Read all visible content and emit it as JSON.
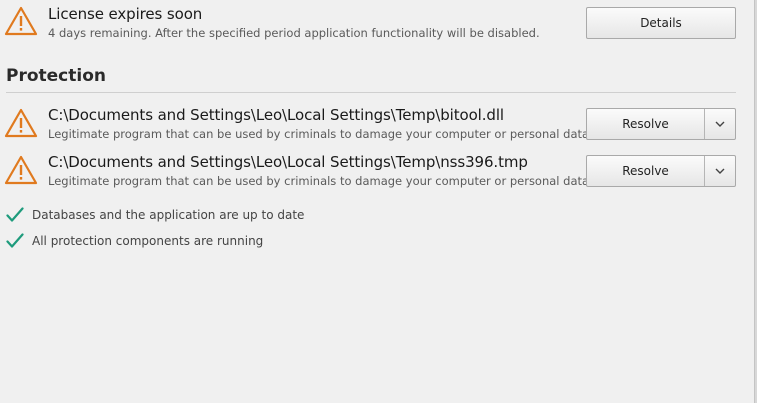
{
  "license": {
    "title": "License expires soon",
    "description": "4 days remaining. After the specified period application functionality will be disabled.",
    "details_label": "Details"
  },
  "protection": {
    "section_title": "Protection",
    "threats": [
      {
        "path": "C:\\Documents and Settings\\Leo\\Local Settings\\Temp\\bitool.dll",
        "description": "Legitimate program that can be used by criminals to damage your computer or personal data.",
        "action_label": "Resolve"
      },
      {
        "path": "C:\\Documents and Settings\\Leo\\Local Settings\\Temp\\nss396.tmp",
        "description": "Legitimate program that can be used by criminals to damage your computer or personal data.",
        "action_label": "Resolve"
      }
    ],
    "status_items": [
      {
        "text": "Databases and the application are up to date"
      },
      {
        "text": "All protection components are running"
      }
    ]
  },
  "icons": {
    "warning": "warning-triangle-icon",
    "check": "checkmark-icon",
    "dropdown": "chevron-down-icon"
  },
  "colors": {
    "warning": "#e07a1f",
    "check": "#1e9b7c",
    "background": "#f0f0f0"
  }
}
